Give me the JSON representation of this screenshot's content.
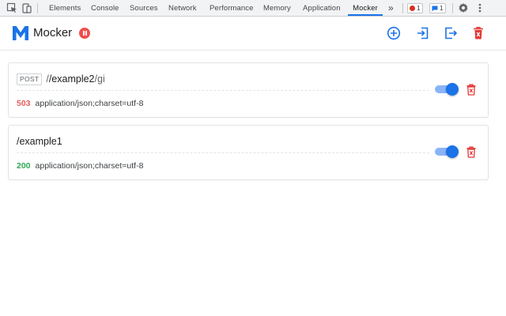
{
  "devtools": {
    "tabs": [
      {
        "label": "Elements"
      },
      {
        "label": "Console"
      },
      {
        "label": "Sources"
      },
      {
        "label": "Network"
      },
      {
        "label": "Performance"
      },
      {
        "label": "Memory"
      },
      {
        "label": "Application"
      },
      {
        "label": "Mocker",
        "active": true
      }
    ],
    "overflow_label": "»",
    "error_count": "1",
    "message_count": "1",
    "icons": [
      "inspect-element-icon",
      "device-toolbar-icon",
      "settings-gear-icon",
      "more-vert-icon"
    ]
  },
  "app": {
    "title": "Mocker",
    "logo_letter": "M",
    "accent_color": "#1a73e8",
    "pause_color": "#ef4f4f",
    "header_actions": [
      "add-circle-icon",
      "import-icon",
      "export-icon",
      "delete-all-icon"
    ]
  },
  "mocks": [
    {
      "method": "POST",
      "url_prefix": "/",
      "url": "/example2",
      "url_flags": "/gi",
      "status": "503",
      "status_color": "#e35d5d",
      "content_type": "application/json;charset=utf-8",
      "enabled": true
    },
    {
      "url": "/example1",
      "status": "200",
      "status_color": "#34a853",
      "content_type": "application/json;charset=utf-8",
      "enabled": true
    }
  ]
}
